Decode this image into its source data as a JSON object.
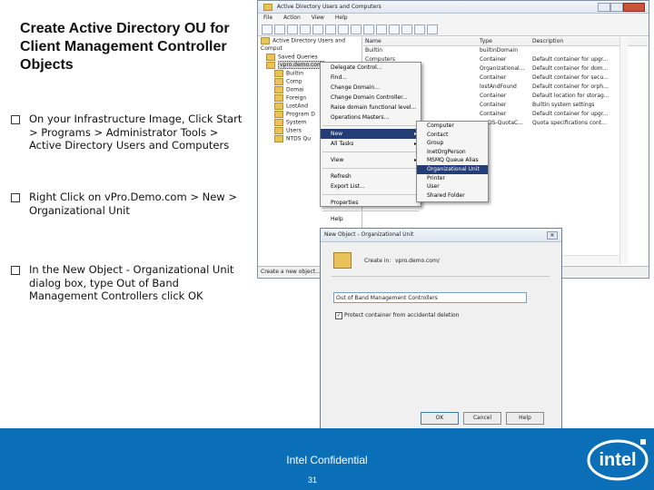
{
  "slide": {
    "title": "Create Active Directory OU for Client Management Controller Objects",
    "bullets": [
      "On your Infrastructure Image, Click Start > Programs > Administrator Tools > Active Directory Users and Computers",
      "Right Click on vPro.Demo.com > New > Organizational Unit",
      "In the New Object - Organizational Unit dialog box, type Out of Band Management Controllers click OK"
    ],
    "footer_text": "Intel Confidential",
    "page_number": "31",
    "logo_text": "intel"
  },
  "aduc": {
    "title": "Active Directory Users and Computers",
    "menu": [
      "File",
      "Action",
      "View",
      "Help"
    ],
    "tree": [
      "Active Directory Users and Comput",
      "Saved Queries",
      "vpro.demo.com",
      "Builtin",
      "Comp",
      "Domai",
      "Foreign",
      "LostAnd",
      "Program D",
      "System",
      "Users",
      "NTDS Qu"
    ],
    "columns": [
      "Name",
      "Type",
      "Description"
    ],
    "rows": [
      {
        "name": "Builtin",
        "type": "builtinDomain",
        "desc": ""
      },
      {
        "name": "Computers",
        "type": "Container",
        "desc": "Default container for upgr..."
      },
      {
        "name": "",
        "type": "Organizational...",
        "desc": "Default container for dom..."
      },
      {
        "name": "",
        "type": "Container",
        "desc": "Default container for secu..."
      },
      {
        "name": "",
        "type": "lostAndFound",
        "desc": "Default container for orph..."
      },
      {
        "name": "",
        "type": "Container",
        "desc": "Default location for storag..."
      },
      {
        "name": "",
        "type": "Container",
        "desc": "Builtin system settings"
      },
      {
        "name": "",
        "type": "Container",
        "desc": "Default container for upgr..."
      },
      {
        "name": "",
        "type": "msDS-QuotaC...",
        "desc": "Quota specifications cont..."
      }
    ],
    "status": "Create a new object..."
  },
  "context_menu": {
    "items": [
      "Delegate Control...",
      "Find...",
      "Change Domain...",
      "Change Domain Controller...",
      "Raise domain functional level...",
      "Operations Masters...",
      "New",
      "All Tasks",
      "View",
      "Refresh",
      "Export List...",
      "Properties",
      "Help"
    ],
    "submenu": [
      "Computer",
      "Contact",
      "Group",
      "InetOrgPerson",
      "MSMQ Queue Alias",
      "Organizational Unit",
      "Printer",
      "User",
      "Shared Folder"
    ]
  },
  "dialog": {
    "title": "New Object - Organizational Unit",
    "create_in_label": "Create in:",
    "create_in_value": "vpro.demo.com/",
    "name_value": "Out of Band Management Controllers",
    "protect_label": "Protect container from accidental deletion",
    "ok": "OK",
    "cancel": "Cancel",
    "help": "Help"
  }
}
